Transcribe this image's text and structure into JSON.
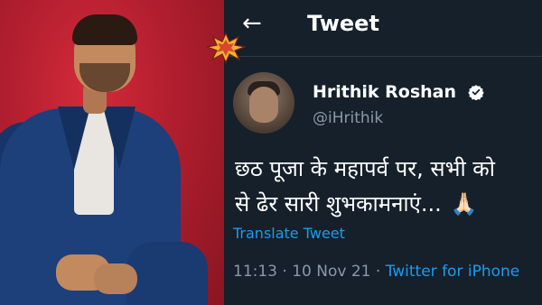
{
  "header": {
    "back_icon": "arrow-left-icon",
    "title": "Tweet"
  },
  "tweet": {
    "author_name": "Hrithik Roshan",
    "author_handle": "@iHrithik",
    "verified_icon": "verified-badge-icon",
    "body": "छठ पूजा के महापर्व पर, सभी को\nसे ढेर सारी शुभकामनाएं...",
    "emoji": "🙏🏻",
    "translate_label": "Translate Tweet",
    "time": "11:13",
    "date": "10 Nov 21",
    "separator": "·",
    "source": "Twitter for iPhone"
  },
  "colors": {
    "background": "#15202b",
    "accent": "#1d9bf0",
    "muted": "#8b98a5",
    "photo_backdrop": "#b01e2e"
  }
}
